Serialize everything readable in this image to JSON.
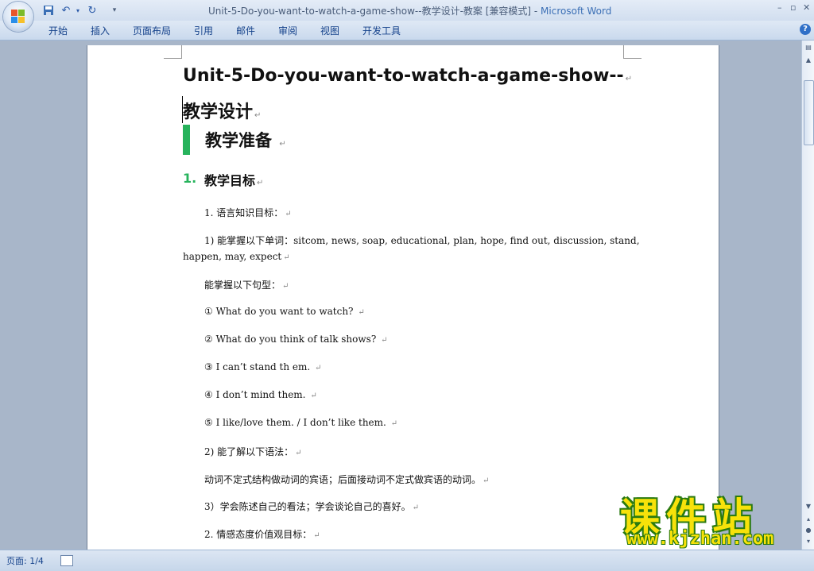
{
  "window": {
    "title_doc": "Unit-5-Do-you-want-to-watch-a-game-show--教学设计-教案 [兼容模式] - ",
    "title_app": "Microsoft Word"
  },
  "ribbon": {
    "tabs": [
      "开始",
      "插入",
      "页面布局",
      "引用",
      "邮件",
      "审阅",
      "视图",
      "开发工具"
    ]
  },
  "document": {
    "title_line1": "Unit-5-Do-you-want-to-watch-a-game-show--",
    "title_line2": "教学设计",
    "heading": "教学准备",
    "section_number": "1.",
    "section_title": "教学目标",
    "paragraphs": [
      "1. 语言知识目标：",
      "1) 能掌握以下单词：sitcom, news, soap, educational, plan, hope, find out, discussion, stand,",
      "happen, may, expect",
      "能掌握以下句型：",
      "① What do you want to watch?",
      "② What do you think of talk shows?",
      "③ I can’t stand th em.",
      "④ I don’t mind them.",
      "⑤ I like/love them. / I don’t like them.",
      "2) 能了解以下语法：",
      "动词不定式结构做动词的宾语；后面接动词不定式做宾语的动词。",
      "3）学会陈述自己的看法；学会谈论自己的喜好。",
      "2. 情感态度价值观目标："
    ],
    "paragraph_mark": "↵"
  },
  "statusbar": {
    "page_info": "页面: 1/4"
  },
  "watermark": {
    "brand": "课件站",
    "url": "www.kjzhan.com"
  },
  "colors": {
    "heading_accent": "#27b35c",
    "ribbon_text": "#15428b",
    "watermark_fill": "#f7e20a"
  }
}
